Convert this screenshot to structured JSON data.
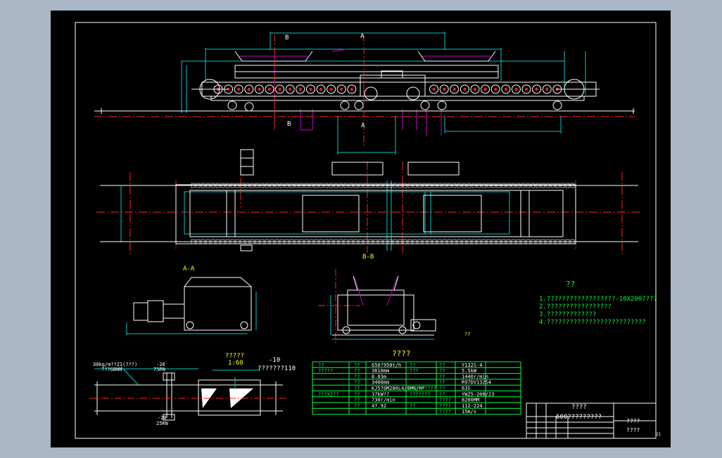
{
  "colors": {
    "background": "#a9b6c6",
    "sheet": "#000000",
    "line": "#ffffff",
    "center": "#ff2020",
    "dimension": "#00c8c8",
    "hidden": "#c800c8",
    "text_yellow": "#ffff00",
    "text_green": "#00ff40"
  },
  "section_markers": {
    "b_top": "B",
    "a_top": "A",
    "b_bottom": "B",
    "a_bottom": "A"
  },
  "view_labels": {
    "section_aa": "A-A",
    "section_bb": "B-B"
  },
  "notes": {
    "heading": "??",
    "lines": [
      "1.??????????????????-10X200????",
      "2.?????????????????",
      "3.?????????????",
      "4.??????????????????????????"
    ]
  },
  "detail": {
    "label_top_left": "30kg/m??21(???)",
    "label_top_left2": "???GBNN",
    "dim_20_top": "-20",
    "dim_75": "75RN",
    "dim_20_bottom": "-20",
    "dim_25": "25RN",
    "scale_title": "?????",
    "scale_value": "1:60",
    "callout_10": "-10",
    "callout_110": "???????110"
  },
  "spec_table": {
    "title": "????",
    "marker": "??",
    "rows": [
      [
        "??",
        "??",
        "650?950t/h",
        "??",
        "??",
        "Y132S-4"
      ],
      [
        "?????",
        "??",
        "3610mm",
        "???",
        "??",
        "5.5kW"
      ],
      [
        "",
        "??",
        "8.03m",
        "",
        "??",
        "1440r/min"
      ],
      [
        "",
        "??",
        "3400mm",
        "",
        "??",
        "R97DV132S4"
      ],
      [
        "",
        "??",
        "KJ570M280L4/BMG/HF",
        "?????????",
        "??",
        "63S"
      ],
      [
        "???X2??",
        "??",
        "37kW??",
        "???????",
        "??",
        "YWZ5-200/23"
      ],
      [
        "",
        "??",
        "730r/min",
        "",
        "????",
        "8200MM"
      ],
      [
        "",
        "??",
        "47.92",
        "??",
        "????",
        "112-224"
      ],
      [
        "",
        "",
        "",
        "",
        "????",
        "15m/s"
      ]
    ]
  },
  "title_block": {
    "drawing_title": "????",
    "subtitle": "600?????????",
    "field_a": "????",
    "field_b": "????",
    "sheet_no": "21"
  }
}
